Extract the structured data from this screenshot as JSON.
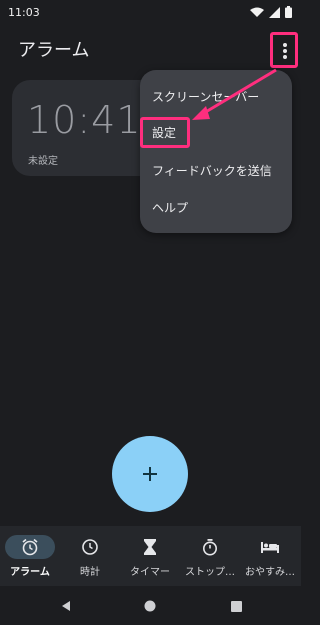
{
  "status_bar": {
    "time": "11:03"
  },
  "app_bar": {
    "title": "アラーム"
  },
  "alarm": {
    "time": "10:41",
    "label": "未設定"
  },
  "menu": {
    "items": [
      "スクリーンセーバー",
      "設定",
      "フィードバックを送信",
      "ヘルプ"
    ],
    "highlighted_index": 1
  },
  "bottom_nav": {
    "items": [
      {
        "label": "アラーム",
        "icon": "alarm-clock-icon",
        "active": true
      },
      {
        "label": "時計",
        "icon": "clock-icon",
        "active": false
      },
      {
        "label": "タイマー",
        "icon": "hourglass-icon",
        "active": false
      },
      {
        "label": "ストップ…",
        "icon": "stopwatch-icon",
        "active": false
      },
      {
        "label": "おやすみ…",
        "icon": "bed-icon",
        "active": false
      }
    ]
  },
  "colors": {
    "background": "#1c1d20",
    "card": "#2c2e33",
    "menu": "#3f4147",
    "fab": "#8bd0f7",
    "highlight": "#ff2e7e",
    "active_nav_pill": "#3b4e5c"
  }
}
